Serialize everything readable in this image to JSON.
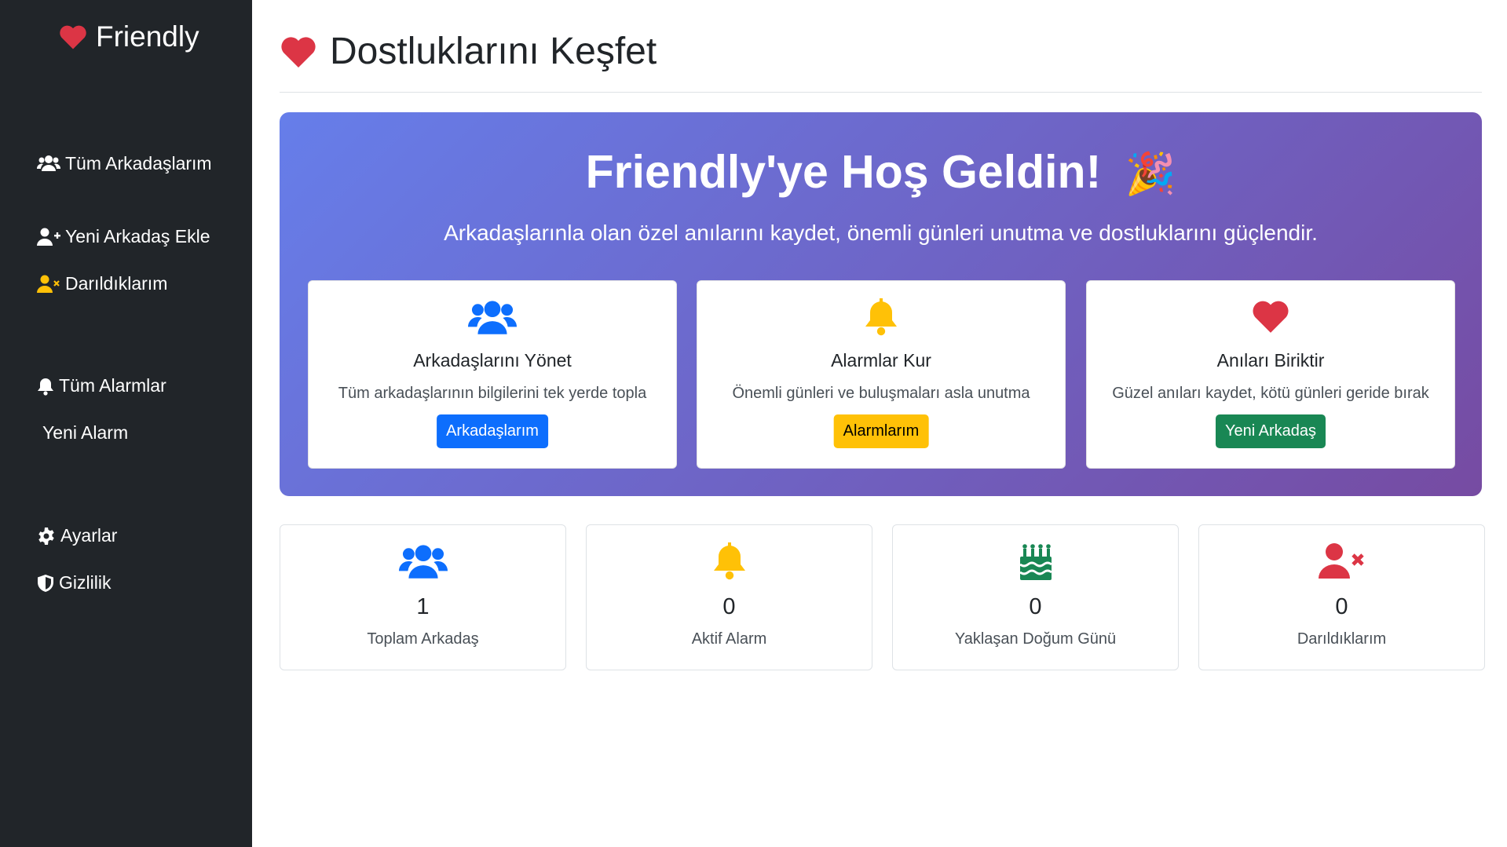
{
  "sidebar": {
    "brand": "Friendly",
    "items": [
      {
        "label": "Tüm Arkadaşlarım",
        "icon": "users-icon"
      },
      {
        "label": "Yeni Arkadaş Ekle",
        "icon": "user-plus-icon"
      },
      {
        "label": "Darıldıklarım",
        "icon": "user-xmark-icon"
      },
      {
        "label": "Tüm Alarmlar",
        "icon": "bell-icon"
      },
      {
        "label": "Yeni Alarm"
      },
      {
        "label": "Ayarlar",
        "icon": "gear-icon"
      },
      {
        "label": "Gizlilik",
        "icon": "shield-icon"
      }
    ]
  },
  "header": {
    "title": "Dostluklarını Keşfet",
    "icon": "heart-icon"
  },
  "hero": {
    "title": "Friendly'ye Hoş Geldin!",
    "title_emoji": "🎉",
    "subtitle": "Arkadaşlarınla olan özel anılarını kaydet, önemli günleri unutma ve dostluklarını güçlendir."
  },
  "features": [
    {
      "title": "Arkadaşlarını Yönet",
      "desc": "Tüm arkadaşlarının bilgilerini tek yerde topla",
      "button": "Arkadaşlarım",
      "icon": "users-icon",
      "color": "#0d6efd"
    },
    {
      "title": "Alarmlar Kur",
      "desc": "Önemli günleri ve buluşmaları asla unutma",
      "button": "Alarmlarım",
      "icon": "bell-icon",
      "color": "#ffc107"
    },
    {
      "title": "Anıları Biriktir",
      "desc": "Güzel anıları kaydet, kötü günleri geride bırak",
      "button": "Yeni Arkadaş",
      "icon": "heart-icon",
      "color": "#dc3545"
    }
  ],
  "stats": [
    {
      "value": "1",
      "label": "Toplam Arkadaş",
      "icon": "users-icon",
      "color": "#0d6efd"
    },
    {
      "value": "0",
      "label": "Aktif Alarm",
      "icon": "bell-icon",
      "color": "#ffc107"
    },
    {
      "value": "0",
      "label": "Yaklaşan Doğum Günü",
      "icon": "cake-icon",
      "color": "#198754"
    },
    {
      "value": "0",
      "label": "Darıldıklarım",
      "icon": "user-xmark-icon",
      "color": "#dc3545"
    }
  ],
  "colors": {
    "sidebar_bg": "#212529",
    "accent_yellow": "#ffc107",
    "gradient_start": "#667eea",
    "gradient_end": "#764ba2"
  }
}
